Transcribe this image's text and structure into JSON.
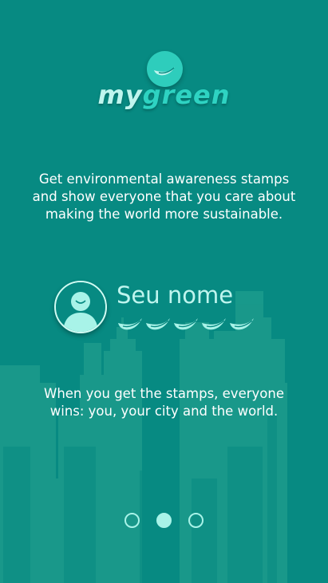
{
  "app": {
    "logo_my": "my",
    "logo_green": "green",
    "logo_icon": "leaf-icon"
  },
  "onboarding": {
    "intro_text": "Get environmental awareness stamps and show everyone that you care about making the world more sustainable.",
    "profile_name": "Seu nome",
    "stamps_count": 5,
    "outro_text": "When you get the stamps, everyone wins: you, your city and the world.",
    "pages_total": 3,
    "current_page": 2
  },
  "colors": {
    "background": "#078a82",
    "accent": "#2ecdbc",
    "light_accent": "#bff5ee",
    "skyline": "#2aa694"
  }
}
